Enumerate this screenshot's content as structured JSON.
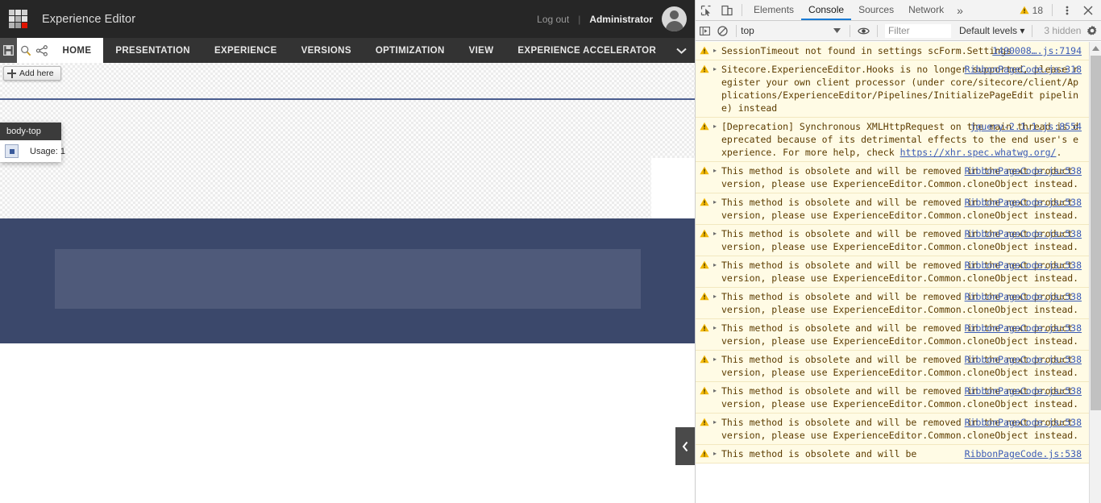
{
  "experience_editor": {
    "app_title": "Experience Editor",
    "logo_icon": "sitecore-grid-logo",
    "account": {
      "logout_label": "Log out",
      "separator": "|",
      "user_name": "Administrator",
      "avatar_icon": "user-avatar-icon"
    },
    "ribbon": {
      "quick_actions": [
        {
          "name": "save-button",
          "icon": "floppy-disk-icon"
        },
        {
          "name": "search-button",
          "icon": "magnifier-icon"
        },
        {
          "name": "publish-button",
          "icon": "share-nodes-icon"
        }
      ],
      "tabs": [
        {
          "label": "HOME",
          "active": true
        },
        {
          "label": "PRESENTATION",
          "active": false
        },
        {
          "label": "EXPERIENCE",
          "active": false
        },
        {
          "label": "VERSIONS",
          "active": false
        },
        {
          "label": "OPTIMIZATION",
          "active": false
        },
        {
          "label": "VIEW",
          "active": false
        },
        {
          "label": "EXPERIENCE ACCELERATOR",
          "active": false
        }
      ],
      "expand_icon": "chevron-down-icon"
    },
    "canvas": {
      "add_here_label": "Add here",
      "add_here_icon": "plus-icon",
      "placeholder_tooltip": {
        "title": "body-top",
        "chip_icon": "placeholder-icon",
        "usage_label": "Usage: 1"
      },
      "collapse_icon": "chevron-left-icon"
    },
    "colors": {
      "topbar": "#262626",
      "ribbon": "#333333",
      "logo_accent": "#e01400",
      "placeholder_border": "#4a5d8f",
      "dark_band": "#3b486b"
    }
  },
  "devtools": {
    "toolbar": {
      "inspect_icon": "inspect-element-icon",
      "device_icon": "device-toolbar-icon",
      "tabs": [
        {
          "label": "Elements",
          "active": false
        },
        {
          "label": "Console",
          "active": true
        },
        {
          "label": "Sources",
          "active": false
        },
        {
          "label": "Network",
          "active": false
        }
      ],
      "more_tabs_label": "»",
      "warning_icon": "warning-triangle-icon",
      "warning_count": "18",
      "menu_icon": "kebab-menu-icon",
      "close_icon": "close-icon"
    },
    "filterbar": {
      "sidebar_icon": "console-sidebar-icon",
      "clear_icon": "clear-console-icon",
      "context_value": "top",
      "context_caret_icon": "chevron-down-icon",
      "eye_icon": "live-expression-eye-icon",
      "filter_placeholder": "Filter",
      "filter_value": "",
      "levels_label": "Default levels",
      "levels_caret_icon": "chevron-down-icon",
      "hidden_label": "3 hidden",
      "settings_icon": "gear-icon"
    },
    "scrollbar": {
      "up_icon": "scroll-up-arrow-icon"
    },
    "messages": [
      {
        "level": "warning",
        "icon": "warning-triangle-icon",
        "expander": "▸",
        "text": "SessionTimeout not found in settings scForm.Settings",
        "source": "1490008….js:7194"
      },
      {
        "level": "warning",
        "icon": "warning-triangle-icon",
        "expander": "▸",
        "text": "Sitecore.ExperienceEditor.Hooks is no longer supported, please register your own client processor (under core/sitecore/client/Applications/ExperienceEditor/Pipelines/InitializePageEdit pipeline) instead",
        "source": "RibbonPageCode.js:318"
      },
      {
        "level": "warning",
        "icon": "warning-triangle-icon",
        "expander": "▸",
        "text": "[Deprecation] Synchronous XMLHttpRequest on the main thread is deprecated because of its detrimental effects to the end user's experience. For more help, check ",
        "link_text": "https://xhr.spec.whatwg.org/",
        "text_after": ".",
        "source": "jquery-2.1.1.js:8554"
      },
      {
        "level": "warning",
        "icon": "warning-triangle-icon",
        "expander": "▸",
        "text": "This method is obsolete and will be removed in the next product version, please use ExperienceEditor.Common.cloneObject instead.",
        "source": "RibbonPageCode.js:538"
      },
      {
        "level": "warning",
        "icon": "warning-triangle-icon",
        "expander": "▸",
        "text": "This method is obsolete and will be removed in the next product version, please use ExperienceEditor.Common.cloneObject instead.",
        "source": "RibbonPageCode.js:538"
      },
      {
        "level": "warning",
        "icon": "warning-triangle-icon",
        "expander": "▸",
        "text": "This method is obsolete and will be removed in the next product version, please use ExperienceEditor.Common.cloneObject instead.",
        "source": "RibbonPageCode.js:538"
      },
      {
        "level": "warning",
        "icon": "warning-triangle-icon",
        "expander": "▸",
        "text": "This method is obsolete and will be removed in the next product version, please use ExperienceEditor.Common.cloneObject instead.",
        "source": "RibbonPageCode.js:538"
      },
      {
        "level": "warning",
        "icon": "warning-triangle-icon",
        "expander": "▸",
        "text": "This method is obsolete and will be removed in the next product version, please use ExperienceEditor.Common.cloneObject instead.",
        "source": "RibbonPageCode.js:538"
      },
      {
        "level": "warning",
        "icon": "warning-triangle-icon",
        "expander": "▸",
        "text": "This method is obsolete and will be removed in the next product version, please use ExperienceEditor.Common.cloneObject instead.",
        "source": "RibbonPageCode.js:538"
      },
      {
        "level": "warning",
        "icon": "warning-triangle-icon",
        "expander": "▸",
        "text": "This method is obsolete and will be removed in the next product version, please use ExperienceEditor.Common.cloneObject instead.",
        "source": "RibbonPageCode.js:538"
      },
      {
        "level": "warning",
        "icon": "warning-triangle-icon",
        "expander": "▸",
        "text": "This method is obsolete and will be removed in the next product version, please use ExperienceEditor.Common.cloneObject instead.",
        "source": "RibbonPageCode.js:538"
      },
      {
        "level": "warning",
        "icon": "warning-triangle-icon",
        "expander": "▸",
        "text": "This method is obsolete and will be removed in the next product version, please use ExperienceEditor.Common.cloneObject instead.",
        "source": "RibbonPageCode.js:538"
      },
      {
        "level": "warning",
        "icon": "warning-triangle-icon",
        "expander": "▸",
        "text": "This method is obsolete and will be",
        "source": "RibbonPageCode.js:538"
      }
    ]
  }
}
